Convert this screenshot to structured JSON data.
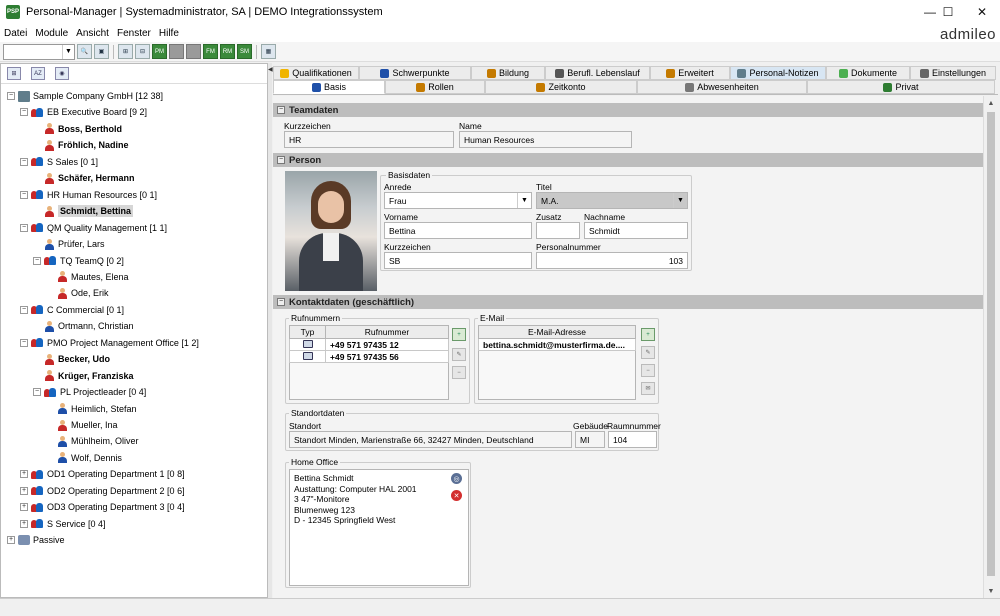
{
  "window": {
    "app_icon_text": "PSP",
    "title": "Personal-Manager | Systemadministrator, SA | DEMO Integrationssystem",
    "minimize": "—",
    "maximize": "☐",
    "close": "✕"
  },
  "menu": [
    "Datei",
    "Module",
    "Ansicht",
    "Fenster",
    "Hilfe"
  ],
  "brand": "admileo",
  "toolbar": {
    "combo_value": "",
    "combo_arrow": "▼",
    "buttons": [
      {
        "icon": "search-icon",
        "glyph": "🔍"
      },
      {
        "icon": "save-icon",
        "glyph": "▣"
      },
      {
        "icon": "org-icon",
        "glyph": "⊞"
      },
      {
        "icon": "person-key-icon",
        "glyph": "⊟"
      },
      {
        "icon": "module-green-1-icon",
        "glyph": "PM"
      },
      {
        "icon": "module-gray-1-icon",
        "glyph": ""
      },
      {
        "icon": "module-gray-2-icon",
        "glyph": ""
      },
      {
        "icon": "module-green-2-icon",
        "glyph": "FM"
      },
      {
        "icon": "module-green-3-icon",
        "glyph": "RM"
      },
      {
        "icon": "module-green-4-icon",
        "glyph": "SM"
      },
      {
        "icon": "layout-icon",
        "glyph": "▦"
      }
    ]
  },
  "tree_toolbar": [
    {
      "icon": "org-chart-icon",
      "glyph": "⊞"
    },
    {
      "icon": "alphabetic-list-icon",
      "glyph": "AZ"
    },
    {
      "icon": "round-icon",
      "glyph": "◉"
    }
  ],
  "splitter_arrow": "◀",
  "tree": [
    {
      "label": "Sample Company GmbH [12 38]",
      "type": "company",
      "expander": "−"
    },
    {
      "label": "EB Executive Board [9 2]",
      "type": "group",
      "expander": "−"
    },
    {
      "label": "Boss, Berthold",
      "type": "person-red",
      "bold": true
    },
    {
      "label": "Fröhlich, Nadine",
      "type": "person-red",
      "bold": true
    },
    {
      "label": "S Sales [0 1]",
      "type": "group",
      "expander": "−"
    },
    {
      "label": "Schäfer, Hermann",
      "type": "person-red",
      "bold": true
    },
    {
      "label": "HR Human Resources [0 1]",
      "type": "group",
      "expander": "−"
    },
    {
      "label": "Schmidt, Bettina",
      "type": "person-red",
      "bold": true,
      "selected": true
    },
    {
      "label": "QM Quality Management [1 1]",
      "type": "group",
      "expander": "−"
    },
    {
      "label": "Prüfer, Lars",
      "type": "person"
    },
    {
      "label": "TQ TeamQ [0 2]",
      "type": "group",
      "expander": "−"
    },
    {
      "label": "Mautes, Elena",
      "type": "person-red"
    },
    {
      "label": "Ode, Erik",
      "type": "person-red"
    },
    {
      "label": "C Commercial [0 1]",
      "type": "group",
      "expander": "−"
    },
    {
      "label": "Ortmann, Christian",
      "type": "person"
    },
    {
      "label": "PMO Project Management Office [1 2]",
      "type": "group",
      "expander": "−"
    },
    {
      "label": "Becker, Udo",
      "type": "person-red",
      "bold": true
    },
    {
      "label": "Krüger, Franziska",
      "type": "person-red",
      "bold": true
    },
    {
      "label": "PL Projectleader [0 4]",
      "type": "group",
      "expander": "−"
    },
    {
      "label": "Heimlich, Stefan",
      "type": "person"
    },
    {
      "label": "Mueller, Ina",
      "type": "person-red"
    },
    {
      "label": "Mühlheim, Oliver",
      "type": "person"
    },
    {
      "label": "Wolf, Dennis",
      "type": "person"
    },
    {
      "label": "OD1 Operating Department 1 [0 8]",
      "type": "group",
      "expander": "+"
    },
    {
      "label": "OD2 Operating Department 2 [0 6]",
      "type": "group",
      "expander": "+"
    },
    {
      "label": "OD3 Operating Department 3 [0 4]",
      "type": "group",
      "expander": "+"
    },
    {
      "label": "S Service [0 4]",
      "type": "group",
      "expander": "+"
    },
    {
      "label": "Passive",
      "type": "passive",
      "expander": "+"
    }
  ],
  "tabs_row1": [
    {
      "label": "Qualifikationen",
      "icon": "star-icon",
      "color": "#f0b400"
    },
    {
      "label": "Schwerpunkte",
      "icon": "person-icon",
      "color": "#1e4fa8"
    },
    {
      "label": "Bildung",
      "icon": "education-icon",
      "color": "#c47a00"
    },
    {
      "label": "Berufl. Lebenslauf",
      "icon": "career-icon",
      "color": "#555"
    },
    {
      "label": "Erweitert",
      "icon": "extended-icon",
      "color": "#c47a00"
    },
    {
      "label": "Personal-Notizen",
      "icon": "notes-icon",
      "color": "#607d8b"
    },
    {
      "label": "Dokumente",
      "icon": "documents-icon",
      "color": "#4caf50"
    },
    {
      "label": "Einstellungen",
      "icon": "settings-icon",
      "color": "#666"
    }
  ],
  "tabs_row2": [
    {
      "label": "Basis",
      "icon": "person-icon",
      "color": "#1e4fa8"
    },
    {
      "label": "Rollen",
      "icon": "roles-icon",
      "color": "#c47a00"
    },
    {
      "label": "Zeitkonto",
      "icon": "clock-icon",
      "color": "#c47a00"
    },
    {
      "label": "Abwesenheiten",
      "icon": "calendar-icon",
      "color": "#777"
    },
    {
      "label": "Privat",
      "icon": "private-icon",
      "color": "#2e7d32"
    }
  ],
  "sections": {
    "collapse": "−",
    "teamdaten": "Teamdaten",
    "person": "Person",
    "kontakt": "Kontaktdaten (geschäftlich)"
  },
  "teamdaten": {
    "kurzzeichen_label": "Kurzzeichen",
    "kurzzeichen": "HR",
    "name_label": "Name",
    "name": "Human Resources"
  },
  "person": {
    "basisdaten_label": "Basisdaten",
    "anrede_label": "Anrede",
    "anrede": "Frau",
    "titel_label": "Titel",
    "titel": "M.A.",
    "vorname_label": "Vorname",
    "vorname": "Bettina",
    "zusatz_label": "Zusatz",
    "zusatz": "",
    "nachname_label": "Nachname",
    "nachname": "Schmidt",
    "kurzzeichen_label": "Kurzzeichen",
    "kurzzeichen": "SB",
    "personalnummer_label": "Personalnummer",
    "personalnummer": "103",
    "dropdown_arrow": "▼"
  },
  "kontakt": {
    "rufnummern_label": "Rufnummern",
    "col_typ": "Typ",
    "col_rufnummer": "Rufnummer",
    "phones": [
      {
        "type_icon": "phone-icon",
        "number": "+49 571 97435 12"
      },
      {
        "type_icon": "phone-icon",
        "number": "+49 571 97435 56"
      }
    ],
    "email_label": "E-Mail",
    "col_email": "E-Mail-Adresse",
    "emails": [
      "bettina.schmidt@musterfirma.de...."
    ],
    "standortdaten_label": "Standortdaten",
    "standort_label": "Standort",
    "standort": "Standort Minden, Marienstraße 66, 32427 Minden, Deutschland",
    "gebaeude_label": "Gebäude",
    "gebaeude": "MI",
    "raumnummer_label": "Raumnummer",
    "raumnummer": "104",
    "home_office_label": "Home Office",
    "home_office_lines": [
      "Bettina Schmidt",
      "Austattung: Computer HAL 2001",
      "3 47\"-Monitore",
      "Blumenweg 123",
      "D - 12345 Springfield West"
    ],
    "home_office_buttons": [
      {
        "icon": "info-icon",
        "glyph": "◎",
        "color": "#5a6f95"
      },
      {
        "icon": "delete-icon",
        "glyph": "✕",
        "color": "#d32f2f"
      }
    ]
  },
  "scroll": {
    "up": "▲",
    "down": "▼"
  }
}
